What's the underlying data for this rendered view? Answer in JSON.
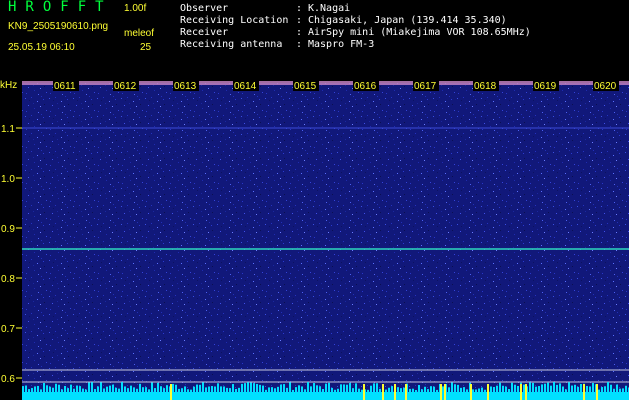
{
  "header": {
    "app_title": "HROFFT",
    "version": "1.00f",
    "filename": "KN9_2505190610.png",
    "meleof_label": "meleof",
    "datetime": "25.05.19 06:10",
    "count": "25"
  },
  "info": [
    {
      "label": "Observer",
      "value": "K.Nagai"
    },
    {
      "label": "Receiving Location",
      "value": "Chigasaki, Japan (139.414 35.340)"
    },
    {
      "label": "Receiver",
      "value": "AirSpy mini (Miakejima VOR 108.65MHz)"
    },
    {
      "label": "Receiving antenna",
      "value": "Maspro FM-3"
    }
  ],
  "spectrogram": {
    "y_unit": "kHz",
    "y_ticks": [
      "1.1",
      "1.0",
      "0.9",
      "0.8",
      "0.7",
      "0.6"
    ],
    "x_ticks": [
      "0611",
      "0612",
      "0613",
      "0614",
      "0615",
      "0616",
      "0617",
      "0618",
      "0619",
      "0620"
    ],
    "colors": {
      "background": "#101880",
      "tone": "#2ed8c0",
      "tick": "#ffff33",
      "baseline": "#00e0ff"
    }
  }
}
